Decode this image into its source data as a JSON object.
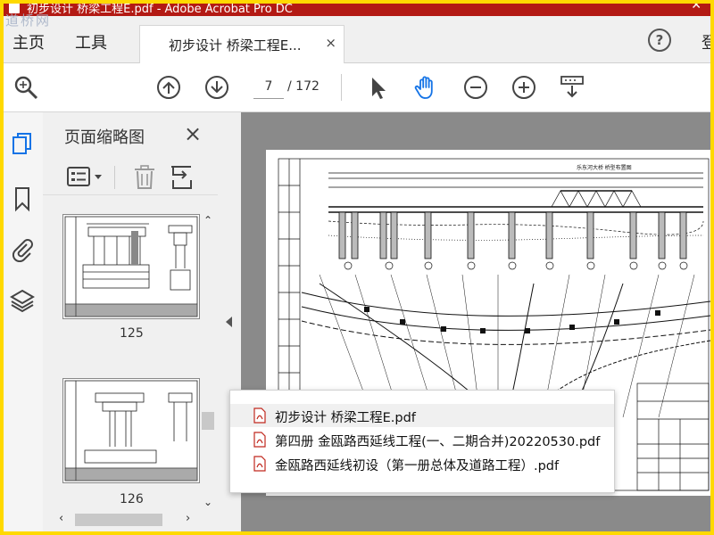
{
  "app": {
    "title": "初步设计 桥梁工程E.pdf - Adobe Acrobat Pro DC",
    "watermark": "道桥网"
  },
  "menu": {
    "home": "主页",
    "tools": "工具",
    "login": "登"
  },
  "tab": {
    "label": "初步设计 桥梁工程E...",
    "close": "×"
  },
  "toolbar": {
    "icons": [
      "zoom-icon",
      "prev-page-icon",
      "next-page-icon",
      "select-cursor-icon",
      "hand-tool-icon",
      "zoom-out-icon",
      "zoom-in-icon",
      "scroll-mode-icon"
    ],
    "current_page": "7",
    "total_pages": "/ 172",
    "accent": "#1473e6"
  },
  "thumbnails_panel": {
    "title": "页面缩略图",
    "close": "×",
    "pages": [
      {
        "number": "125"
      },
      {
        "number": "126"
      }
    ]
  },
  "recent_files": [
    {
      "name": "初步设计 桥梁工程E.pdf"
    },
    {
      "name": "第四册 金瓯路西延线工程(一、二期合并)20220530.pdf"
    },
    {
      "name": "金瓯路西延线初设（第一册总体及道路工程）.pdf"
    }
  ],
  "drawing": {
    "title": "乐东河大桥 桥型布置图"
  }
}
